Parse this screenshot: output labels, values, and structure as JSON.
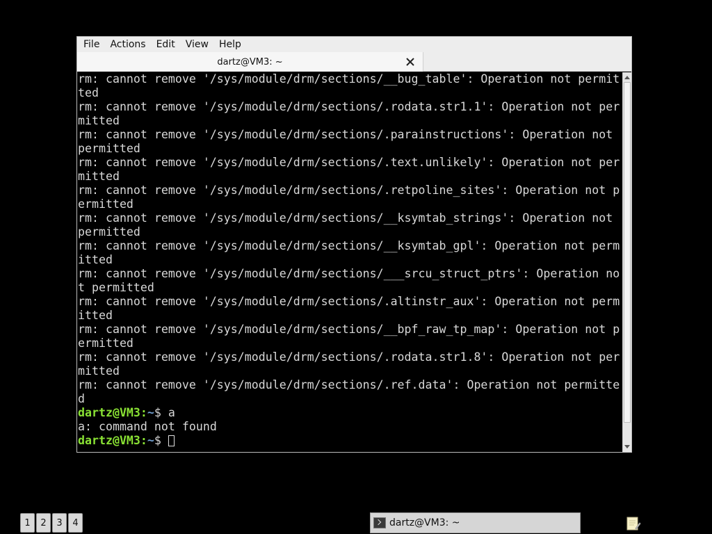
{
  "window": {
    "menu": [
      "File",
      "Actions",
      "Edit",
      "View",
      "Help"
    ],
    "tab_title": "dartz@VM3: ~"
  },
  "terminal": {
    "lines": [
      {
        "text": "rm: cannot remove '/sys/module/drm/sections/__bug_table': Operation not permit"
      },
      {
        "text": "ted"
      },
      {
        "text": "rm: cannot remove '/sys/module/drm/sections/.rodata.str1.1': Operation not per"
      },
      {
        "text": "mitted"
      },
      {
        "text": "rm: cannot remove '/sys/module/drm/sections/.parainstructions': Operation not"
      },
      {
        "text": "permitted"
      },
      {
        "text": "rm: cannot remove '/sys/module/drm/sections/.text.unlikely': Operation not per"
      },
      {
        "text": "mitted"
      },
      {
        "text": "rm: cannot remove '/sys/module/drm/sections/.retpoline_sites': Operation not p"
      },
      {
        "text": "ermitted"
      },
      {
        "text": "rm: cannot remove '/sys/module/drm/sections/__ksymtab_strings': Operation not"
      },
      {
        "text": "permitted"
      },
      {
        "text": "rm: cannot remove '/sys/module/drm/sections/__ksymtab_gpl': Operation not perm"
      },
      {
        "text": "itted"
      },
      {
        "text": "rm: cannot remove '/sys/module/drm/sections/___srcu_struct_ptrs': Operation no"
      },
      {
        "text": "t permitted"
      },
      {
        "text": "rm: cannot remove '/sys/module/drm/sections/.altinstr_aux': Operation not perm"
      },
      {
        "text": "itted"
      },
      {
        "text": "rm: cannot remove '/sys/module/drm/sections/__bpf_raw_tp_map': Operation not p"
      },
      {
        "text": "ermitted"
      },
      {
        "text": "rm: cannot remove '/sys/module/drm/sections/.rodata.str1.8': Operation not per"
      },
      {
        "text": "mitted"
      },
      {
        "text": "rm: cannot remove '/sys/module/drm/sections/.ref.data': Operation not permitte"
      },
      {
        "text": "d"
      },
      {
        "user": "dartz@VM3",
        "sep": ":",
        "path": "~",
        "sym": "$ ",
        "cmd": "a"
      },
      {
        "text": "a: command not found"
      },
      {
        "user": "dartz@VM3",
        "sep": ":",
        "path": "~",
        "sym": "$ ",
        "cmd": "",
        "cursor": true
      }
    ]
  },
  "taskbar": {
    "workspaces": [
      "1",
      "2",
      "3",
      "4"
    ],
    "task_label": "dartz@VM3: ~",
    "task_icon": "terminal-icon",
    "tray_icon": "notes-icon"
  },
  "colors": {
    "prompt_user": "#8ae234",
    "prompt_path": "#729fcf",
    "terminal_bg": "#000000",
    "terminal_fg": "#d8d8d8"
  }
}
